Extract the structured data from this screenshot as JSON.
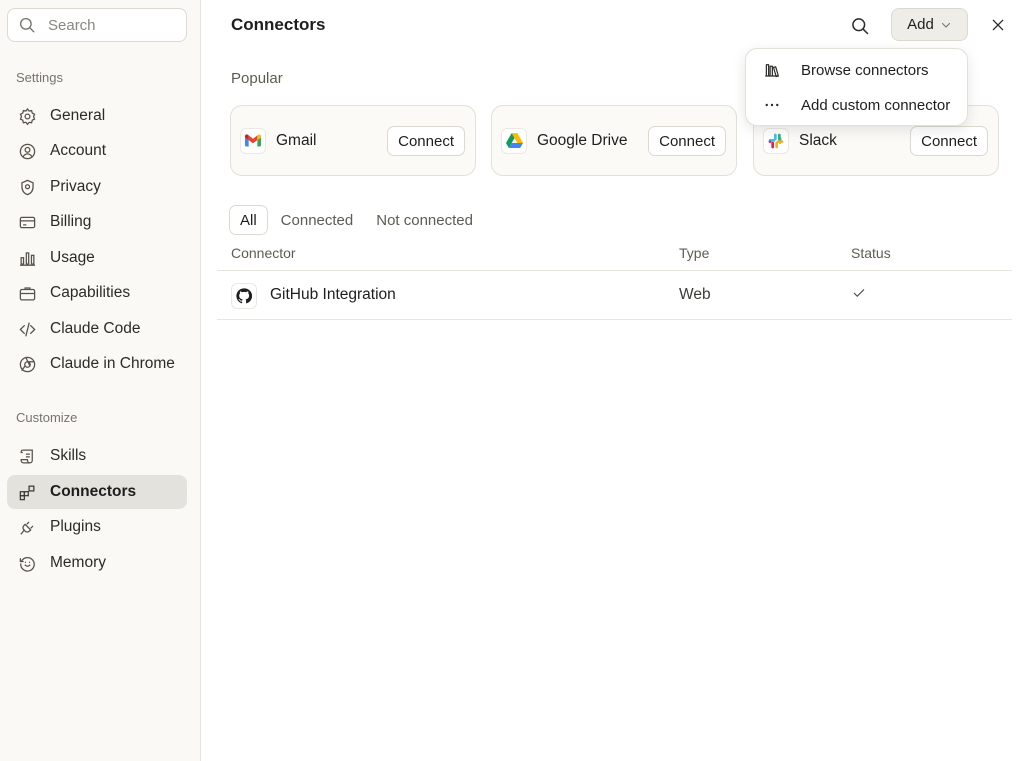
{
  "sidebar": {
    "search_placeholder": "Search",
    "settings_label": "Settings",
    "settings_items": [
      {
        "label": "General",
        "icon": "gear-icon"
      },
      {
        "label": "Account",
        "icon": "user-circle-icon"
      },
      {
        "label": "Privacy",
        "icon": "shield-icon"
      },
      {
        "label": "Billing",
        "icon": "credit-card-icon"
      },
      {
        "label": "Usage",
        "icon": "bar-chart-icon"
      },
      {
        "label": "Capabilities",
        "icon": "briefcase-icon"
      },
      {
        "label": "Claude Code",
        "icon": "code-icon"
      },
      {
        "label": "Claude in Chrome",
        "icon": "globe-icon"
      }
    ],
    "customize_label": "Customize",
    "customize_items": [
      {
        "label": "Skills",
        "icon": "scroll-icon"
      },
      {
        "label": "Connectors",
        "icon": "connectors-icon",
        "active": true
      },
      {
        "label": "Plugins",
        "icon": "plug-icon"
      },
      {
        "label": "Memory",
        "icon": "memory-icon"
      }
    ]
  },
  "header": {
    "title": "Connectors",
    "add_label": "Add"
  },
  "add_menu": {
    "items": [
      {
        "label": "Browse connectors",
        "icon": "library-icon"
      },
      {
        "label": "Add custom connector",
        "icon": "more-horizontal-icon"
      }
    ]
  },
  "popular": {
    "label": "Popular",
    "cards": [
      {
        "name": "Gmail",
        "icon": "gmail-icon",
        "button": "Connect"
      },
      {
        "name": "Google Drive",
        "icon": "google-drive-icon",
        "button": "Connect"
      },
      {
        "name": "Slack",
        "icon": "slack-icon",
        "button": "Connect"
      }
    ]
  },
  "tabs": [
    "All",
    "Connected",
    "Not connected"
  ],
  "table": {
    "columns": [
      "Connector",
      "Type",
      "Status"
    ],
    "rows": [
      {
        "name": "GitHub Integration",
        "type": "Web",
        "status": "connected",
        "icon": "github-icon"
      }
    ]
  },
  "colors": {
    "sidebar_bg": "#faf9f5",
    "active_item_bg": "#e4e2dc",
    "add_button_bg": "#efede7"
  }
}
